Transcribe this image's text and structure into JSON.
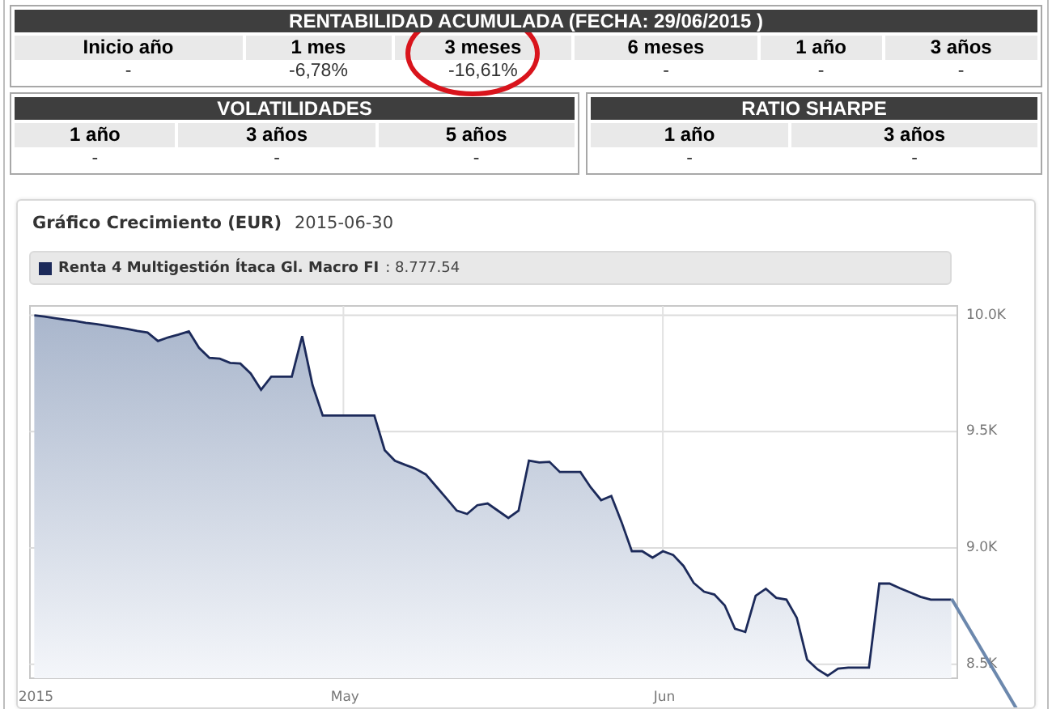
{
  "returns": {
    "title": "RENTABILIDAD ACUMULADA (FECHA:  29/06/2015 )",
    "columns": [
      "Inicio año",
      "1 mes",
      "3 meses",
      "6 meses",
      "1 año",
      "3 años"
    ],
    "values": [
      "-",
      "-6,78%",
      "-16,61%",
      "-",
      "-",
      "-"
    ]
  },
  "volatility": {
    "title": "VOLATILIDADES",
    "columns": [
      "1 año",
      "3 años",
      "5 años"
    ],
    "values": [
      "-",
      "-",
      "-"
    ]
  },
  "sharpe": {
    "title": "RATIO SHARPE",
    "columns": [
      "1 año",
      "3 años"
    ],
    "values": [
      "-",
      "-"
    ]
  },
  "chart": {
    "date": "2015-06-30",
    "legend": {
      "value": ": 8.777.54"
    },
    "chart_data": {
      "type": "area",
      "title": "Gráfico Crecimiento (EUR)",
      "categories": [
        "2015",
        null,
        null,
        null,
        null,
        null,
        null,
        null,
        null,
        null,
        null,
        null,
        null,
        null,
        null,
        null,
        null,
        null,
        null,
        null,
        null,
        null,
        null,
        null,
        null,
        null,
        null,
        null,
        null,
        null,
        "May",
        null,
        null,
        null,
        null,
        null,
        null,
        null,
        null,
        null,
        null,
        null,
        null,
        null,
        null,
        null,
        null,
        null,
        null,
        null,
        null,
        null,
        null,
        null,
        null,
        null,
        null,
        null,
        null,
        null,
        null,
        "Jun",
        null,
        null,
        null,
        null,
        null,
        null,
        null,
        null,
        null,
        null,
        null,
        null,
        null,
        null,
        null,
        null,
        null,
        null,
        null,
        null,
        null,
        null,
        null,
        null,
        null,
        null,
        null,
        null
      ],
      "series": [
        {
          "name": "Renta 4 Multigestión Ítaca Gl. Macro FI",
          "color": "#1c2a5a",
          "values": [
            10000,
            9994,
            9987,
            9981,
            9975,
            9968,
            9962,
            9955,
            9948,
            9941,
            9933,
            9926,
            9889,
            9905,
            9917,
            9931,
            9860,
            9817,
            9813,
            9795,
            9792,
            9750,
            9680,
            9736,
            9736,
            9736,
            9910,
            9700,
            9569,
            9569,
            9569,
            9569,
            9569,
            9569,
            9420,
            9375,
            9357,
            9340,
            9316,
            9264,
            9213,
            9161,
            9146,
            9184,
            9191,
            9160,
            9129,
            9160,
            9375,
            9367,
            9370,
            9326,
            9326,
            9326,
            9260,
            9205,
            9223,
            9110,
            8986,
            8986,
            8958,
            8986,
            8970,
            8923,
            8850,
            8812,
            8800,
            8753,
            8653,
            8639,
            8795,
            8825,
            8786,
            8778,
            8700,
            8520,
            8478,
            8451,
            8481,
            8486,
            8486,
            8486,
            8847,
            8847,
            8827,
            8809,
            8790,
            8778,
            8778,
            8778
          ]
        }
      ],
      "ylim": [
        8440,
        10040
      ],
      "grid": true,
      "yticks": [
        {
          "value": 10000,
          "label": "10.0K"
        },
        {
          "value": 9500,
          "label": "9.5K"
        },
        {
          "value": 9000,
          "label": "9.0K"
        },
        {
          "value": 8500,
          "label": "8.5K"
        }
      ]
    }
  }
}
